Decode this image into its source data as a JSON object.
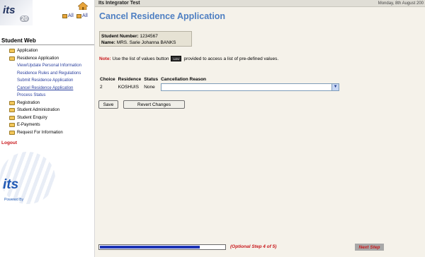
{
  "sidebar": {
    "logo_top_text": "its",
    "logo_version": "20",
    "tool_all_1": "All",
    "tool_all_2": "All",
    "section_title": "Student Web",
    "items": [
      {
        "label": "Application",
        "type": "folder"
      },
      {
        "label": "Residence Application",
        "type": "folder"
      },
      {
        "label": "View/Update Personal Information",
        "type": "sub"
      },
      {
        "label": "Residence Rules and Regulations",
        "type": "sub"
      },
      {
        "label": "Submit Residence Application",
        "type": "sub"
      },
      {
        "label": "Cancel Residence Application",
        "type": "sub",
        "active": true
      },
      {
        "label": "Process Status",
        "type": "sub"
      },
      {
        "label": "Registration",
        "type": "folder"
      },
      {
        "label": "Student Administration",
        "type": "folder"
      },
      {
        "label": "Student Enquiry",
        "type": "folder"
      },
      {
        "label": "E-Payments",
        "type": "folder"
      },
      {
        "label": "Request For Information",
        "type": "folder"
      }
    ],
    "logout": "Logout",
    "logo_bottom_text": "its",
    "powered_by": "Powered By"
  },
  "header": {
    "title": "Its Integrator Test",
    "date": "Monday, 8th August 200"
  },
  "page_title": "Cancel Residence Application",
  "student": {
    "number_label": "Student Number:",
    "number": "1234567",
    "name_label": "Name:",
    "name": "MRS. Sarie Johanna BANKS"
  },
  "note": {
    "label": "Note:",
    "text_before": "Use the list of values button",
    "button_text": "LOV",
    "text_after": "provided to access a list of pre-defined values."
  },
  "table": {
    "headers": [
      "Choice",
      "Residence",
      "Status",
      "Cancellation Reason"
    ],
    "rows": [
      {
        "choice": "2",
        "residence": "KOSHUIS",
        "status": "None",
        "reason": ""
      }
    ]
  },
  "buttons": {
    "save": "Save",
    "revert": "Revert Changes"
  },
  "footer": {
    "progress_fraction": 0.8,
    "step_text": "(Optional Step 4 of 5)",
    "next_step": "Next Step"
  },
  "colors": {
    "title": "#4e7fc2",
    "note_label": "#c8171b",
    "progress_fill": "#1c33b5"
  }
}
